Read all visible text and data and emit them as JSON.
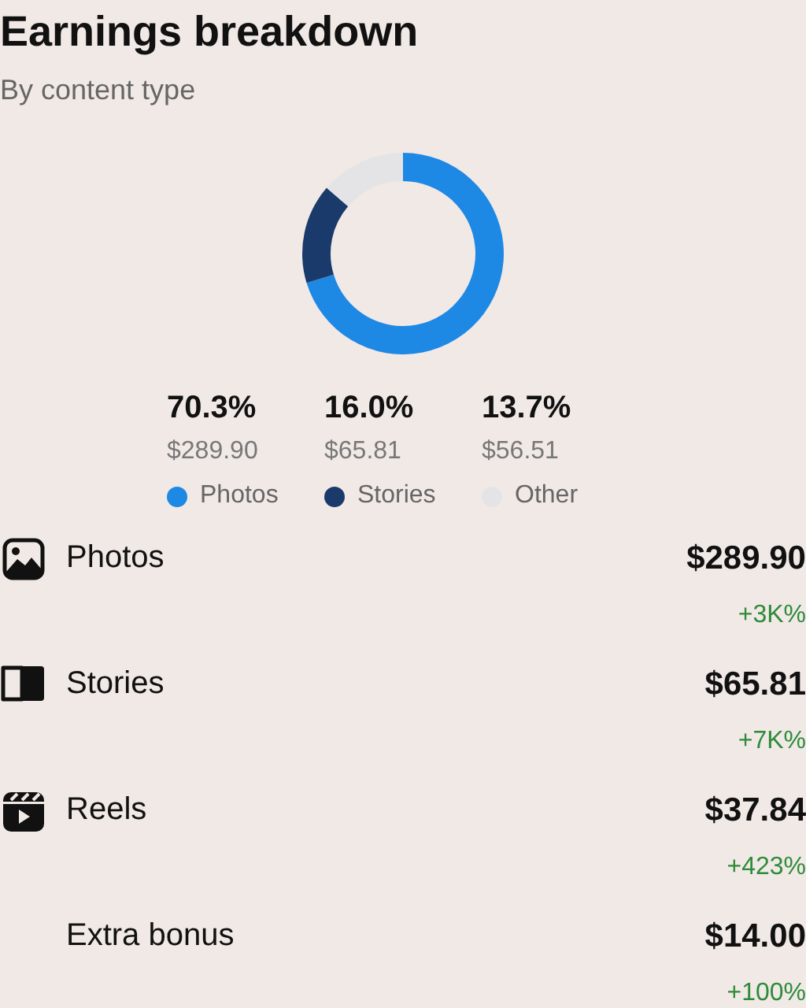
{
  "title": "Earnings breakdown",
  "subtitle": "By content type",
  "chart_data": {
    "type": "donut",
    "categories": [
      "Photos",
      "Stories",
      "Other"
    ],
    "series": [
      {
        "values": [
          70.3,
          16.0,
          13.7
        ]
      }
    ]
  },
  "legend": [
    {
      "percent": "70.3%",
      "amount": "$289.90",
      "color": "#1e88e5"
    },
    {
      "percent": "16.0%",
      "amount": "$65.81",
      "color": "#1a3a6b"
    },
    {
      "percent": "13.7%",
      "amount": "$56.51",
      "color": "#e4e4e6"
    }
  ],
  "rows": [
    {
      "kind": "photos",
      "name": "Photos",
      "amount": "$289.90",
      "change": "+3K%"
    },
    {
      "kind": "stories",
      "name": "Stories",
      "amount": "$65.81",
      "change": "+7K%"
    },
    {
      "kind": "reels",
      "name": "Reels",
      "amount": "$37.84",
      "change": "+423%"
    },
    {
      "kind": "plain",
      "name": "Extra bonus",
      "amount": "$14.00",
      "change": "+100%"
    }
  ]
}
